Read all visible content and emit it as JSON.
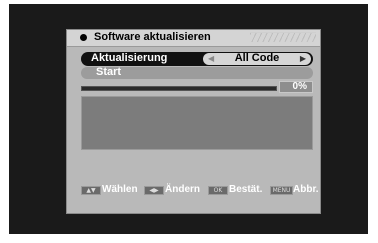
{
  "window": {
    "title": "Software aktualisieren"
  },
  "menu": {
    "row1": {
      "label": "Aktualisierung",
      "value": "All Code"
    },
    "row2": {
      "label": "Start"
    }
  },
  "progress": {
    "percent_text": "0%",
    "value": 0
  },
  "footer": {
    "select_key": "▲▼",
    "select_label": "Wählen",
    "change_key": "◀▶",
    "change_label": "Ändern",
    "ok_key": "OK",
    "ok_label": "Bestät.",
    "menu_key": "MENU",
    "menu_label": "Abbr."
  },
  "colors": {
    "panel_bg": "#b9b9b9",
    "highlight": "#111111",
    "screen_bg": "#1a1a1a"
  }
}
